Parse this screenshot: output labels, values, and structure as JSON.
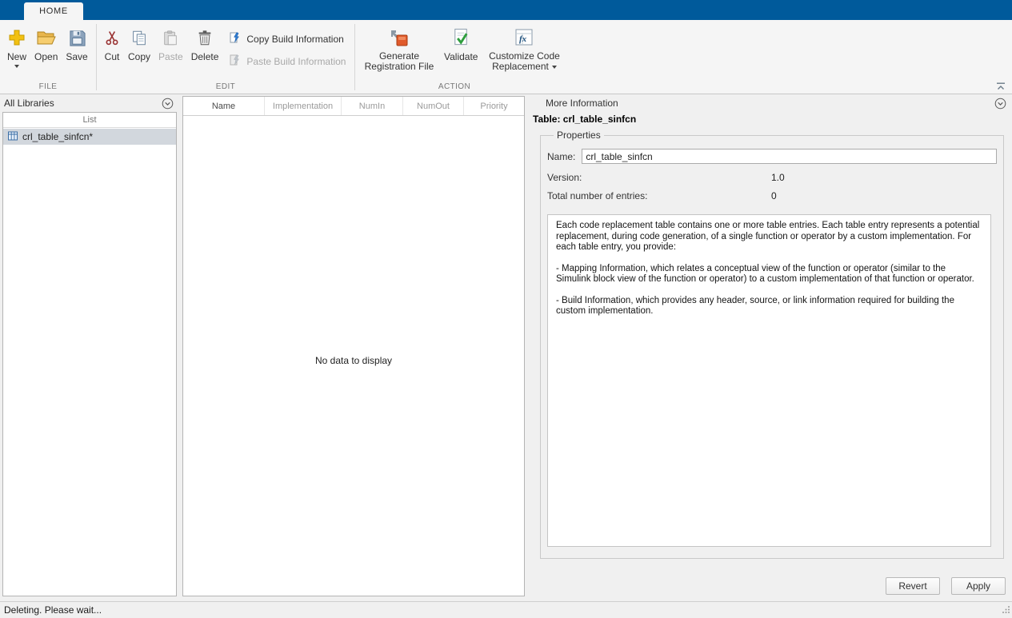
{
  "window": {
    "home_tab": "HOME"
  },
  "ribbon": {
    "file": {
      "label": "FILE",
      "new": "New",
      "open": "Open",
      "save": "Save"
    },
    "edit": {
      "label": "EDIT",
      "cut": "Cut",
      "copy": "Copy",
      "paste": "Paste",
      "delete": "Delete",
      "copy_build": "Copy Build Information",
      "paste_build": "Paste Build Information"
    },
    "action": {
      "label": "ACTION",
      "generate": "Generate Registration File",
      "validate": "Validate",
      "customize": "Customize Code Replacement"
    }
  },
  "left_panel": {
    "title": "All Libraries",
    "list_header": "List",
    "items": [
      {
        "label": "crl_table_sinfcn*"
      }
    ]
  },
  "table_panel": {
    "columns": [
      "Name",
      "Implementation",
      "NumIn",
      "NumOut",
      "Priority"
    ],
    "empty_message": "No data to display"
  },
  "right_panel": {
    "title": "More Information",
    "table_label": "Table: crl_table_sinfcn",
    "properties": {
      "legend": "Properties",
      "name_label": "Name:",
      "name_value": "crl_table_sinfcn",
      "version_label": "Version:",
      "version_value": "1.0",
      "entries_label": "Total number of entries:",
      "entries_value": "0"
    },
    "description": [
      "Each code replacement table contains one or more table entries. Each table entry represents a potential replacement, during code generation, of a single function or operator by a custom implementation. For each table entry, you provide:",
      "- Mapping Information, which relates a conceptual view of the function or operator (similar to the Simulink block view of the function or operator) to a custom implementation of that function or operator.",
      "- Build Information, which provides any header, source, or link information required for building the custom implementation."
    ],
    "revert_button": "Revert",
    "apply_button": "Apply"
  },
  "statusbar": {
    "text": "Deleting. Please wait..."
  },
  "colors": {
    "titlebar_blue": "#005a9b",
    "ribbon_bg": "#f5f5f5",
    "panel_bg": "#f0f0f0",
    "selection_gray": "#d2d7dd",
    "validate_green": "#2e9e3e",
    "generate_orange": "#e05a2b"
  }
}
